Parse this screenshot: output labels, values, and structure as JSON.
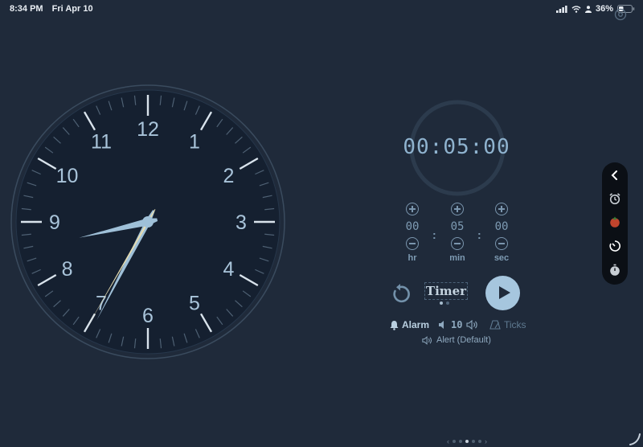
{
  "status_bar": {
    "time": "8:34 PM",
    "date": "Fri Apr 10",
    "battery": "36%"
  },
  "clock": {
    "numerals": [
      "12",
      "1",
      "2",
      "3",
      "4",
      "5",
      "6",
      "7",
      "8",
      "9",
      "10",
      "11"
    ],
    "hour": 8,
    "minute": 34,
    "second": 35
  },
  "timer": {
    "display": "00:05:00",
    "hours": {
      "value": "00",
      "label": "hr"
    },
    "minutes": {
      "value": "05",
      "label": "min"
    },
    "seconds": {
      "value": "00",
      "label": "sec"
    },
    "separator": ":",
    "mode_label": "Timer",
    "page_dots": 2,
    "active_dot": 0
  },
  "options": {
    "alarm_label": "Alarm",
    "volume": "10",
    "ticks_label": "Ticks",
    "alert_label": "Alert (Default)"
  },
  "sidebar": {
    "items": [
      "chevron-left-icon",
      "alarm-clock-icon",
      "tomato-icon",
      "timer-icon",
      "stopwatch-icon"
    ]
  },
  "pager": {
    "count": 5,
    "active": 2,
    "left": "‹",
    "right": "›"
  },
  "colors": {
    "background": "#1f2a3a",
    "accent": "#a6c6de",
    "clock_face": "#152030",
    "second_hand": "#e6dcb0"
  }
}
